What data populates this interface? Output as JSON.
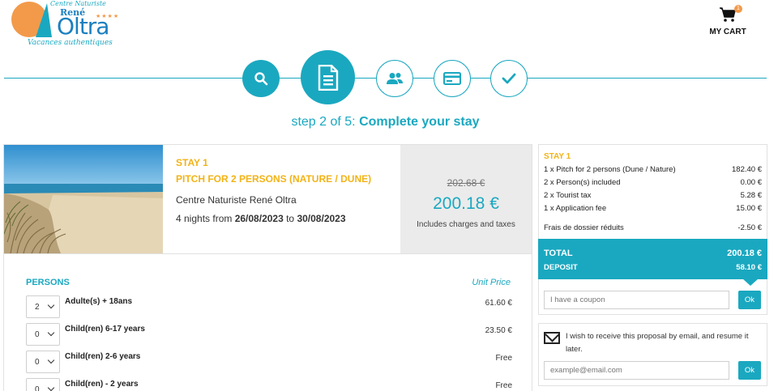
{
  "header": {
    "logo": {
      "top_text": "Centre Naturiste",
      "name_small": "René",
      "name_big": "Oltra",
      "stars": "★★★★",
      "tagline": "Vacances authentiques"
    },
    "cart": {
      "label": "MY CART",
      "count": "1"
    }
  },
  "steps": {
    "items": [
      {
        "icon": "search-icon",
        "state": "done"
      },
      {
        "icon": "document-icon",
        "state": "current"
      },
      {
        "icon": "users-icon",
        "state": "todo"
      },
      {
        "icon": "credit-card-icon",
        "state": "todo"
      },
      {
        "icon": "check-icon",
        "state": "todo"
      }
    ],
    "title_prefix": "step 2 of 5: ",
    "title_main": "Complete your stay"
  },
  "stay": {
    "label": "STAY 1",
    "pitch": "PITCH FOR 2 PERSONS (NATURE / DUNE)",
    "camp": "Centre Naturiste René Oltra",
    "nights_text": "4 nights from ",
    "date_from": "26/08/2023",
    "to_text": " to ",
    "date_to": "30/08/2023",
    "old_price": "202.68 €",
    "new_price": "200.18 €",
    "price_note": "Includes charges and taxes"
  },
  "persons": {
    "heading": "PERSONS",
    "unit_heading": "Unit Price",
    "rows": [
      {
        "qty": "2",
        "label": "Adulte(s) + 18ans",
        "price": "61.60 €"
      },
      {
        "qty": "0",
        "label": "Child(ren) 6-17 years",
        "price": "23.50 €"
      },
      {
        "qty": "0",
        "label": "Child(ren) 2-6 years",
        "price": "Free"
      },
      {
        "qty": "0",
        "label": "Child(ren) - 2 years",
        "price": "Free"
      }
    ]
  },
  "summary": {
    "stay_label": "STAY 1",
    "lines": [
      {
        "label": "1 x Pitch for 2 persons (Dune / Nature)",
        "amount": "182.40 €"
      },
      {
        "label": "2 x Person(s) included",
        "amount": "0.00 €"
      },
      {
        "label": "2 x Tourist tax",
        "amount": "5.28 €"
      },
      {
        "label": "1 x Application fee",
        "amount": "15.00 €"
      },
      {
        "label": "Frais de dossier réduits",
        "amount": "-2.50 €"
      }
    ],
    "total_label": "TOTAL",
    "total_amount": "200.18 €",
    "deposit_label": "DEPOSIT",
    "deposit_amount": "58.10 €",
    "coupon_placeholder": "I have a coupon",
    "ok_label": "Ok"
  },
  "email_box": {
    "text": "I wish to receive this proposal by email, and resume it later.",
    "placeholder": "example@email.com",
    "ok_label": "Ok"
  },
  "colors": {
    "accent": "#1aa8c0",
    "highlight": "#f2b316",
    "sun": "#f29a4a"
  }
}
